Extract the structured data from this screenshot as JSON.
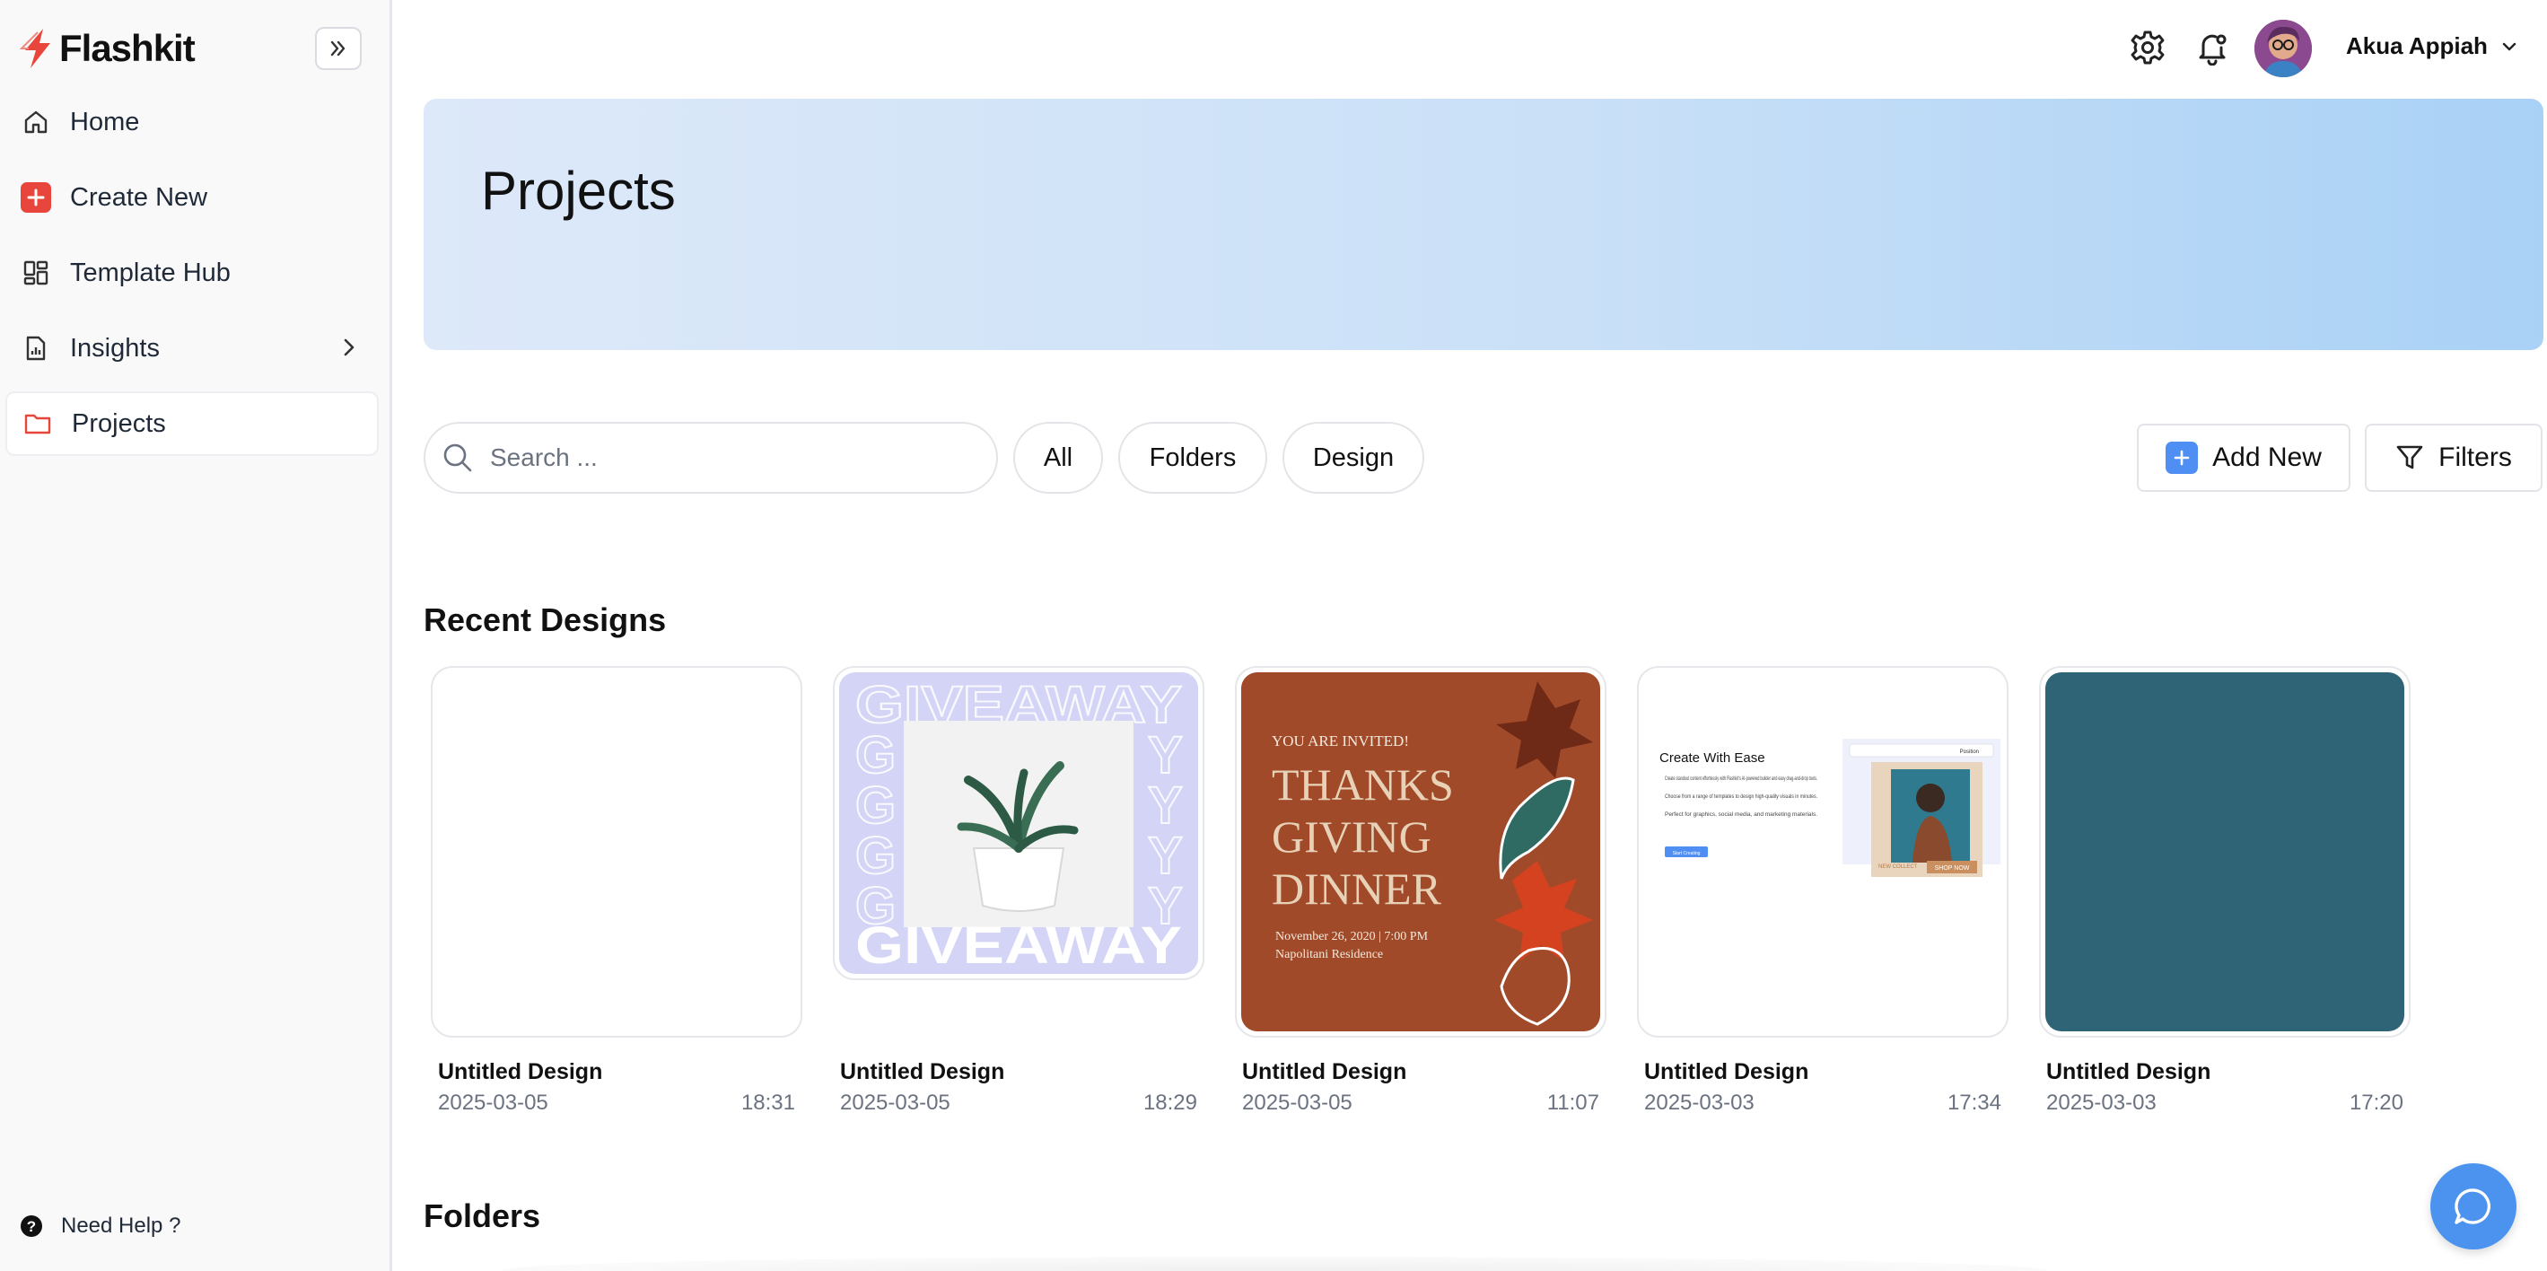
{
  "app": {
    "name": "Flashkit",
    "brand_color": "#e8453c",
    "accent_color": "#4f8ff3"
  },
  "sidebar": {
    "items": [
      {
        "label": "Home",
        "icon": "home-icon"
      },
      {
        "label": "Create New",
        "icon": "plus-square-icon"
      },
      {
        "label": "Template Hub",
        "icon": "grid-icon"
      },
      {
        "label": "Insights",
        "icon": "report-icon"
      },
      {
        "label": "Projects",
        "icon": "folder-icon",
        "active": true
      }
    ],
    "help_label": "Need Help ?"
  },
  "topbar": {
    "user_name": "Akua Appiah"
  },
  "banner": {
    "title": "Projects"
  },
  "toolbar": {
    "search_placeholder": "Search ...",
    "filters": [
      "All",
      "Folders",
      "Design"
    ],
    "add_new_label": "Add New",
    "filters_label": "Filters"
  },
  "recent": {
    "title": "Recent Designs",
    "cards": [
      {
        "name": "Untitled Design",
        "date": "2025-03-05",
        "time": "18:31"
      },
      {
        "name": "Untitled Design",
        "date": "2025-03-05",
        "time": "18:29"
      },
      {
        "name": "Untitled Design",
        "date": "2025-03-05",
        "time": "11:07"
      },
      {
        "name": "Untitled Design",
        "date": "2025-03-03",
        "time": "17:34"
      },
      {
        "name": "Untitled Design",
        "date": "2025-03-03",
        "time": "17:20"
      }
    ]
  },
  "thumbnails": {
    "giveaway": {
      "word": "GIVEAWAY",
      "bg": "#d3d4f6"
    },
    "thanksgiving": {
      "kicker": "YOU ARE INVITED!",
      "line1": "THANKS",
      "line2": "GIVING",
      "line3": "DINNER",
      "details1": "November 26, 2020 | 7:00 PM",
      "details2": "Napolitani Residence",
      "bg": "#a14a2a"
    },
    "create": {
      "title": "Create With Ease",
      "b1": "Create standout content effortlessly with Flashkit's AI-powered builder and easy drag-and-drop tools.",
      "b2": "Choose from a range of templates to design high-quality visuals in minutes.",
      "b3": "Perfect for graphics, social media, and marketing materials.",
      "cta": "Start Creating",
      "shop": "SHOP NOW",
      "new_label": "NEW COLLECT",
      "position": "Position"
    },
    "teal": {
      "bg": "#2f6477"
    }
  },
  "folders": {
    "title": "Folders"
  }
}
